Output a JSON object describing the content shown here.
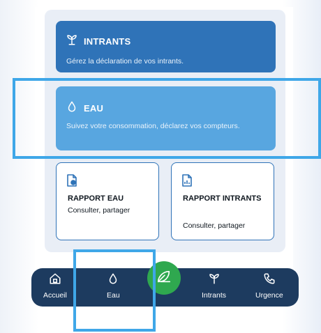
{
  "colors": {
    "intrants_tile": "#2f73b8",
    "eau_tile": "#58a6e0",
    "nav_bg": "#1d3b5f",
    "fab": "#2fa84f",
    "highlight": "#3fa7e8"
  },
  "tiles": {
    "intrants": {
      "icon": "seedling-icon",
      "title": "INTRANTS",
      "description": "Gérez la déclaration de vos intrants."
    },
    "eau": {
      "icon": "water-drop-icon",
      "title": "EAU",
      "description": "Suivez votre consommation, déclarez vos compteurs."
    }
  },
  "reports": {
    "eau": {
      "icon": "document-chart-icon",
      "title": "RAPPORT EAU",
      "subtitle": "Consulter, partager"
    },
    "intrants": {
      "icon": "document-chart-icon",
      "title": "RAPPORT INTRANTS",
      "subtitle": "Consulter, partager"
    }
  },
  "nav": {
    "items": [
      {
        "label": "Accueil",
        "icon": "home-icon"
      },
      {
        "label": "Eau",
        "icon": "water-drop-icon"
      },
      {
        "label": "",
        "icon": "leaf-icon"
      },
      {
        "label": "Intrants",
        "icon": "seedling-icon"
      },
      {
        "label": "Urgence",
        "icon": "phone-icon"
      }
    ]
  }
}
